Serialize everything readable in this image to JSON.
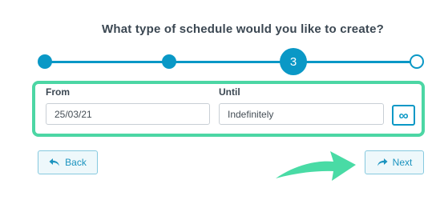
{
  "title": "What type of schedule would you like to create?",
  "stepper": {
    "current_step": "3",
    "total_steps": 4,
    "completed_steps": 2,
    "color": "#0a98c6"
  },
  "from": {
    "label": "From",
    "value": "25/03/21"
  },
  "until": {
    "label": "Until",
    "value": "Indefinitely",
    "toggle_icon": "infinity-icon",
    "toggle_label": "∞"
  },
  "highlight_color": "#4cd6a4",
  "back_button": {
    "label": "Back",
    "icon": "undo-arrow-icon"
  },
  "next_button": {
    "label": "Next",
    "icon": "redo-arrow-icon"
  },
  "pointer_arrow_icon": "pointer-arrow-icon"
}
